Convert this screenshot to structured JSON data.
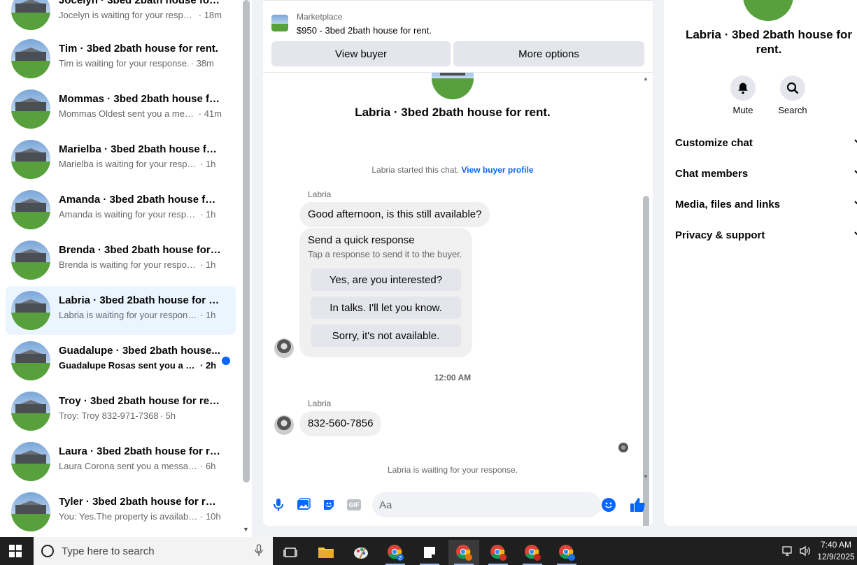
{
  "conversations": [
    {
      "title": "Jocelyn · 3bed 2bath house for r...",
      "snippet": "Jocelyn is waiting for your respon...",
      "time": "· 18m",
      "unread": false,
      "active": false
    },
    {
      "title": "Tim · 3bed 2bath house for rent.",
      "snippet": "Tim is waiting for your response.",
      "time": "· 38m",
      "unread": false,
      "active": false
    },
    {
      "title": "Mommas · 3bed 2bath house fo...",
      "snippet": "Mommas Oldest sent you a mess...",
      "time": "· 41m",
      "unread": false,
      "active": false
    },
    {
      "title": "Marielba · 3bed 2bath house for...",
      "snippet": "Marielba is waiting for your respon...",
      "time": "· 1h",
      "unread": false,
      "active": false
    },
    {
      "title": "Amanda · 3bed 2bath house for ...",
      "snippet": "Amanda is waiting for your respon...",
      "time": "· 1h",
      "unread": false,
      "active": false
    },
    {
      "title": "Brenda · 3bed 2bath house for r...",
      "snippet": "Brenda is waiting for your response.",
      "time": "· 1h",
      "unread": false,
      "active": false
    },
    {
      "title": "Labria · 3bed 2bath house for re...",
      "snippet": "Labria is waiting for your response.",
      "time": "· 1h",
      "unread": false,
      "active": true
    },
    {
      "title": "Guadalupe · 3bed 2bath house...",
      "snippet": "Guadalupe Rosas sent you a me...",
      "time": "· 2h",
      "unread": true,
      "active": false
    },
    {
      "title": "Troy · 3bed 2bath house for rent.",
      "snippet": "Troy: Troy 832-971-7368",
      "time": "· 5h",
      "unread": false,
      "active": false
    },
    {
      "title": "Laura · 3bed 2bath house for rent.",
      "snippet": "Laura Corona sent you a message a...",
      "time": "· 6h",
      "unread": false,
      "active": false
    },
    {
      "title": "Tyler · 3bed 2bath house for rent.",
      "snippet": "You: Yes.The property is available. ...",
      "time": "· 10h",
      "unread": false,
      "active": false
    }
  ],
  "chat": {
    "marketplace_label": "Marketplace",
    "listing_title": "$950 - 3bed 2bath house for rent.",
    "view_buyer_label": "View buyer",
    "more_options_label": "More options",
    "name": "Labria · 3bed 2bath house for rent.",
    "started_text": "Labria started this chat.",
    "view_profile_link": "View buyer profile",
    "sender_name": "Labria",
    "first_message": "Good afternoon, is this still available?",
    "quick_response": {
      "title": "Send a quick response",
      "subtitle": "Tap a response to send it to the buyer.",
      "options": [
        "Yes, are you interested?",
        "In talks. I'll let you know.",
        "Sorry, it's not available."
      ]
    },
    "time_separator": "12:00 AM",
    "second_message": "832-560-7856",
    "waiting_text": "Labria is waiting for your response.",
    "input_placeholder": "Aa",
    "gif_label": "GIF"
  },
  "details": {
    "name": "Labria · 3bed 2bath house for rent.",
    "actions": [
      {
        "label": "Mute",
        "icon": "bell-icon"
      },
      {
        "label": "Search",
        "icon": "search-icon"
      }
    ],
    "sections": [
      "Customize chat",
      "Chat members",
      "Media, files and links",
      "Privacy & support"
    ]
  },
  "taskbar": {
    "search_placeholder": "Type here to search",
    "time": "7:40 AM",
    "date": "12/9/2025"
  },
  "colors": {
    "accent": "#0866ff",
    "active_row": "#ebf5ff"
  }
}
